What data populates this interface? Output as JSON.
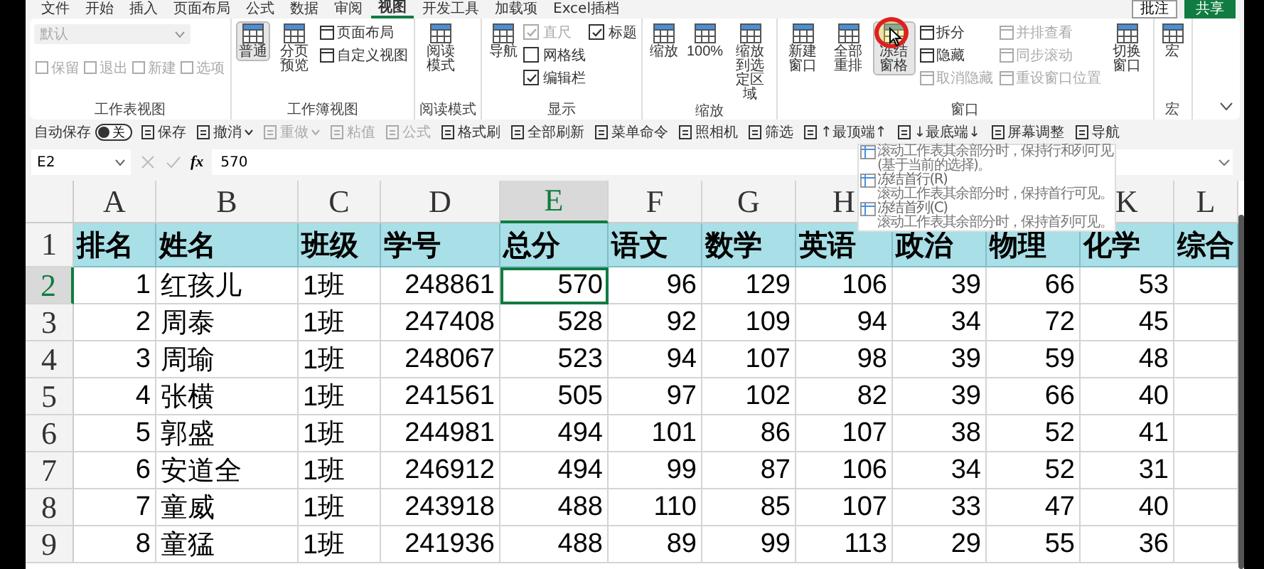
{
  "menu_tabs": [
    {
      "label": "文件",
      "selected": false
    },
    {
      "label": "开始",
      "selected": false
    },
    {
      "label": "插入",
      "selected": false
    },
    {
      "label": "页面布局",
      "selected": false
    },
    {
      "label": "公式",
      "selected": false
    },
    {
      "label": "数据",
      "selected": false
    },
    {
      "label": "审阅",
      "selected": false
    },
    {
      "label": "视图",
      "selected": true
    },
    {
      "label": "开发工具",
      "selected": false
    },
    {
      "label": "加载项",
      "selected": false
    },
    {
      "label": "Excel插档",
      "selected": false
    }
  ],
  "comment_button": "批注",
  "share_button": "共享",
  "ribbon_groups": [
    {
      "label": "工作表视图",
      "columns": [
        [
          {
            "kind": "dropdown",
            "label": "默认",
            "disabled": true
          },
          {
            "kind": "row",
            "items": [
              {
                "label": "保留",
                "disabled": true
              },
              {
                "label": "退出",
                "disabled": true
              },
              {
                "label": "新建",
                "disabled": true
              },
              {
                "label": "选项",
                "disabled": true
              }
            ]
          }
        ]
      ]
    },
    {
      "label": "工作簿视图",
      "columns": [
        [
          {
            "kind": "large",
            "label": "普通",
            "selected": true,
            "highlighted": false
          }
        ],
        [
          {
            "kind": "large",
            "label": "分页预览",
            "selected": false,
            "highlighted": false
          }
        ],
        [
          {
            "kind": "small",
            "label": "页面布局",
            "disabled": false
          },
          {
            "kind": "small",
            "label": "自定义视图",
            "disabled": false
          }
        ]
      ]
    },
    {
      "label": "阅读模式",
      "columns": [
        [
          {
            "kind": "large",
            "label": "阅读模式",
            "selected": false,
            "highlighted": false
          }
        ]
      ]
    },
    {
      "label": "显示",
      "columns": [
        [
          {
            "kind": "large",
            "label": "导航",
            "selected": false,
            "highlighted": false
          }
        ],
        [
          {
            "kind": "check",
            "label": "直尺",
            "checked": true,
            "disabled": true
          },
          {
            "kind": "check",
            "label": "网格线",
            "checked": false,
            "disabled": false
          },
          {
            "kind": "check",
            "label": "编辑栏",
            "checked": true,
            "disabled": false
          }
        ],
        [
          {
            "kind": "check",
            "label": "标题",
            "checked": true,
            "disabled": false
          }
        ]
      ]
    },
    {
      "label": "缩放",
      "columns": [
        [
          {
            "kind": "large",
            "label": "缩放",
            "selected": false,
            "highlighted": false
          }
        ],
        [
          {
            "kind": "large",
            "label": "100%",
            "selected": false,
            "highlighted": false
          }
        ],
        [
          {
            "kind": "large",
            "label": "缩放到选定区域",
            "selected": false,
            "highlighted": false
          }
        ]
      ]
    },
    {
      "label": "窗口",
      "columns": [
        [
          {
            "kind": "large",
            "label": "新建窗口",
            "selected": false,
            "highlighted": false
          }
        ],
        [
          {
            "kind": "large",
            "label": "全部重排",
            "selected": false,
            "highlighted": false
          }
        ],
        [
          {
            "kind": "large",
            "label": "冻结窗格",
            "selected": true,
            "highlighted": true
          }
        ],
        [
          {
            "kind": "small",
            "label": "拆分",
            "disabled": false
          },
          {
            "kind": "small",
            "label": "隐藏",
            "disabled": false
          },
          {
            "kind": "small",
            "label": "取消隐藏",
            "disabled": true
          }
        ],
        [
          {
            "kind": "small",
            "label": "并排查看",
            "disabled": true
          },
          {
            "kind": "small",
            "label": "同步滚动",
            "disabled": true
          },
          {
            "kind": "small",
            "label": "重设窗口位置",
            "disabled": true
          }
        ],
        [
          {
            "kind": "large",
            "label": "切换窗口",
            "selected": false,
            "highlighted": false
          }
        ]
      ]
    },
    {
      "label": "宏",
      "columns": [
        [
          {
            "kind": "large",
            "label": "宏",
            "selected": false,
            "highlighted": false
          }
        ]
      ]
    }
  ],
  "quick_access": [
    {
      "kind": "toggle",
      "label": "自动保存",
      "state": "关",
      "on": false
    },
    {
      "kind": "button",
      "label": "保存",
      "disabled": false
    },
    {
      "kind": "split",
      "label": "撤消",
      "disabled": false
    },
    {
      "kind": "split",
      "label": "重做",
      "disabled": true
    },
    {
      "kind": "button",
      "label": "粘值",
      "disabled": true
    },
    {
      "kind": "button",
      "label": "公式",
      "disabled": true
    },
    {
      "kind": "button",
      "label": "格式刷",
      "disabled": false
    },
    {
      "kind": "button",
      "label": "全部刷新",
      "disabled": false
    },
    {
      "kind": "button",
      "label": "菜单命令",
      "disabled": false
    },
    {
      "kind": "button",
      "label": "照相机",
      "disabled": false
    },
    {
      "kind": "button",
      "label": "筛选",
      "disabled": false
    },
    {
      "kind": "button",
      "label": "↑最顶端↑",
      "disabled": false
    },
    {
      "kind": "button",
      "label": "↓最底端↓",
      "disabled": false
    },
    {
      "kind": "button",
      "label": "屏幕调整",
      "disabled": false
    },
    {
      "kind": "button",
      "label": "导航",
      "disabled": false
    }
  ],
  "formula_bar": {
    "name_box": "E2",
    "function_label": "fx",
    "value": "570"
  },
  "freeze_menu": {
    "items": [
      {
        "description": "滚动工作表其余部分时，保持行和列可见(基于当前的选择)。"
      },
      {
        "title": "冻结首行(R)",
        "description": "滚动工作表其余部分时，保持首行可见。"
      },
      {
        "title": "冻结首列(C)",
        "description": "滚动工作表其余部分时，保持首列可见。"
      }
    ]
  },
  "sheet": {
    "columns": [
      {
        "letter": "A",
        "selected": false
      },
      {
        "letter": "B",
        "selected": false
      },
      {
        "letter": "C",
        "selected": false
      },
      {
        "letter": "D",
        "selected": false
      },
      {
        "letter": "E",
        "selected": true
      },
      {
        "letter": "F",
        "selected": false
      },
      {
        "letter": "G",
        "selected": false
      },
      {
        "letter": "H",
        "selected": false
      },
      {},
      {},
      {
        "letter": "K",
        "selected": false
      },
      {
        "letter": "L",
        "selected": false
      }
    ],
    "rows": [
      {
        "number": "1",
        "kind": "header",
        "selected": false,
        "cells": [
          "排名",
          "姓名",
          "班级",
          "学号",
          "总分",
          "语文",
          "数学",
          "英语",
          "政治",
          "物理",
          "化学",
          "综合"
        ]
      },
      {
        "number": "2",
        "kind": "data",
        "selected": true,
        "cells": [
          "1",
          "红孩儿",
          "1班",
          "248861",
          "570",
          "96",
          "129",
          "106",
          "39",
          "66",
          "53",
          ""
        ]
      },
      {
        "number": "3",
        "kind": "data",
        "selected": false,
        "cells": [
          "2",
          "周泰",
          "1班",
          "247408",
          "528",
          "92",
          "109",
          "94",
          "34",
          "72",
          "45",
          ""
        ]
      },
      {
        "number": "4",
        "kind": "data",
        "selected": false,
        "cells": [
          "3",
          "周瑜",
          "1班",
          "248067",
          "523",
          "94",
          "107",
          "98",
          "39",
          "59",
          "48",
          ""
        ]
      },
      {
        "number": "5",
        "kind": "data",
        "selected": false,
        "cells": [
          "4",
          "张横",
          "1班",
          "241561",
          "505",
          "97",
          "102",
          "82",
          "39",
          "66",
          "40",
          ""
        ]
      },
      {
        "number": "6",
        "kind": "data",
        "selected": false,
        "cells": [
          "5",
          "郭盛",
          "1班",
          "244981",
          "494",
          "101",
          "86",
          "107",
          "38",
          "52",
          "41",
          ""
        ]
      },
      {
        "number": "7",
        "kind": "data",
        "selected": false,
        "cells": [
          "6",
          "安道全",
          "1班",
          "246912",
          "494",
          "99",
          "87",
          "106",
          "34",
          "52",
          "31",
          ""
        ]
      },
      {
        "number": "8",
        "kind": "data",
        "selected": false,
        "cells": [
          "7",
          "童威",
          "1班",
          "243918",
          "488",
          "110",
          "85",
          "107",
          "33",
          "47",
          "40",
          ""
        ]
      },
      {
        "number": "9",
        "kind": "data",
        "selected": false,
        "cells": [
          "8",
          "童猛",
          "1班",
          "241936",
          "488",
          "89",
          "99",
          "113",
          "29",
          "55",
          "36",
          ""
        ]
      }
    ]
  }
}
